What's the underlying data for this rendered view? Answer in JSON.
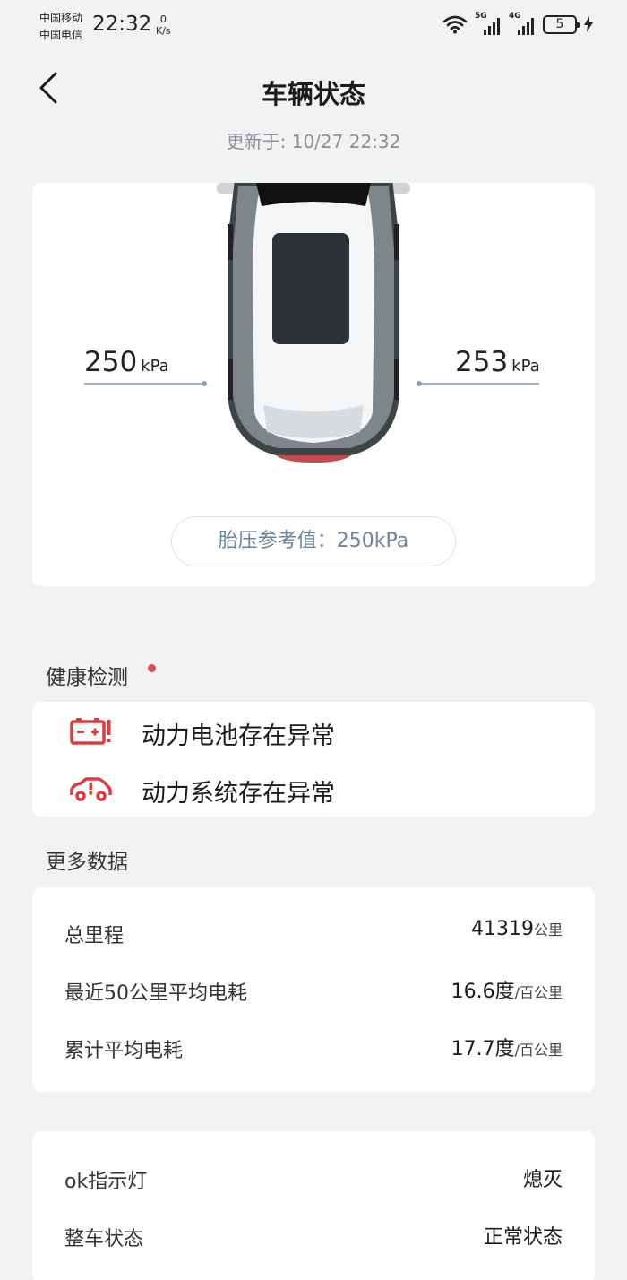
{
  "status_bar": {
    "carrier1": "中国移动",
    "carrier2": "中国电信",
    "time": "22:32",
    "speed_value": "0",
    "speed_unit": "K/s",
    "sig1_tag": "5G",
    "sig2_tag": "4G",
    "battery": "5"
  },
  "header": {
    "title": "车辆状态",
    "updated": "更新于: 10/27 22:32"
  },
  "tire": {
    "left_value": "250",
    "right_value": "253",
    "unit": "kPa",
    "reference": "胎压参考值：250kPa"
  },
  "health": {
    "title": "健康检测",
    "alerts": [
      {
        "icon": "battery-warning-icon",
        "label": "动力电池存在异常"
      },
      {
        "icon": "car-warning-icon",
        "label": "动力系统存在异常"
      }
    ]
  },
  "more": {
    "title": "更多数据",
    "rows": [
      {
        "label": "总里程",
        "value": "41319",
        "unit": "公里"
      },
      {
        "label": "最近50公里平均电耗",
        "value": "16.6度",
        "unit": "/百公里"
      },
      {
        "label": "累计平均电耗",
        "value": "17.7度",
        "unit": "/百公里"
      }
    ]
  },
  "status": {
    "rows": [
      {
        "label": "ok指示灯",
        "value": "熄灭"
      },
      {
        "label": "整车状态",
        "value": "正常状态"
      }
    ]
  },
  "colors": {
    "alert_red": "#e23b3b",
    "accent_blue_gray": "#6c8498"
  }
}
